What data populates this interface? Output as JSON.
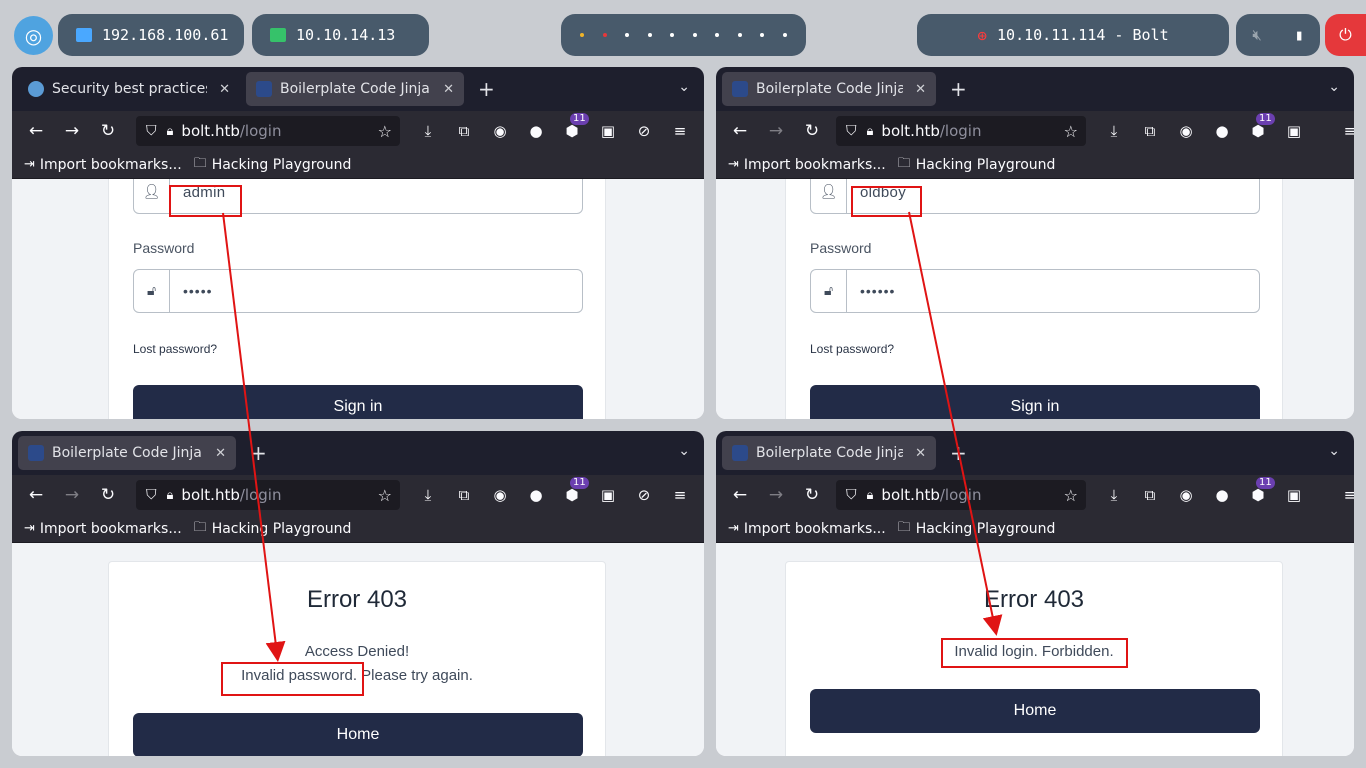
{
  "system_bar": {
    "ip_local": "192.168.100.61",
    "ip_vpn": "10.10.14.13",
    "target": "10.10.11.114 - Bolt",
    "accent": "#4fa3e0",
    "power_color": "#e5383b"
  },
  "windows": {
    "top_left": {
      "tabs": [
        {
          "title": "Security best practices | ",
          "icon": "firefox-icon"
        },
        {
          "title": "Boilerplate Code Jinja - S",
          "icon": "site-favicon"
        }
      ],
      "url_host": "bolt.htb",
      "url_path": "/login",
      "bookmarks": [
        "Import bookmarks...",
        "Hacking Playground"
      ],
      "username": "admin",
      "password_label": "Password",
      "password_mask": "•••••",
      "lost_password": "Lost password?",
      "signin": "Sign in",
      "badge": "11"
    },
    "top_right": {
      "tabs": [
        {
          "title": "Boilerplate Code Jinja - S",
          "icon": "site-favicon"
        }
      ],
      "url_host": "bolt.htb",
      "url_path": "/login",
      "bookmarks": [
        "Import bookmarks...",
        "Hacking Playground"
      ],
      "username": "oldboy",
      "password_label": "Password",
      "password_mask": "••••••",
      "lost_password": "Lost password?",
      "signin": "Sign in",
      "badge": "11"
    },
    "bottom_left": {
      "tabs": [
        {
          "title": "Boilerplate Code Jinja - E",
          "icon": "site-favicon"
        }
      ],
      "url_host": "bolt.htb",
      "url_path": "/login",
      "bookmarks": [
        "Import bookmarks...",
        "Hacking Playground"
      ],
      "error_title": "Error 403",
      "line1": "Access Denied!",
      "line2a": "Invalid password.",
      "line2b": " Please try again.",
      "home": "Home",
      "badge": "11"
    },
    "bottom_right": {
      "tabs": [
        {
          "title": "Boilerplate Code Jinja - E",
          "icon": "site-favicon"
        }
      ],
      "url_host": "bolt.htb",
      "url_path": "/login",
      "bookmarks": [
        "Import bookmarks...",
        "Hacking Playground"
      ],
      "error_title": "Error 403",
      "line1": "Invalid login. Forbidden.",
      "home": "Home",
      "badge": "11"
    }
  },
  "annotation_color": "#e01414"
}
